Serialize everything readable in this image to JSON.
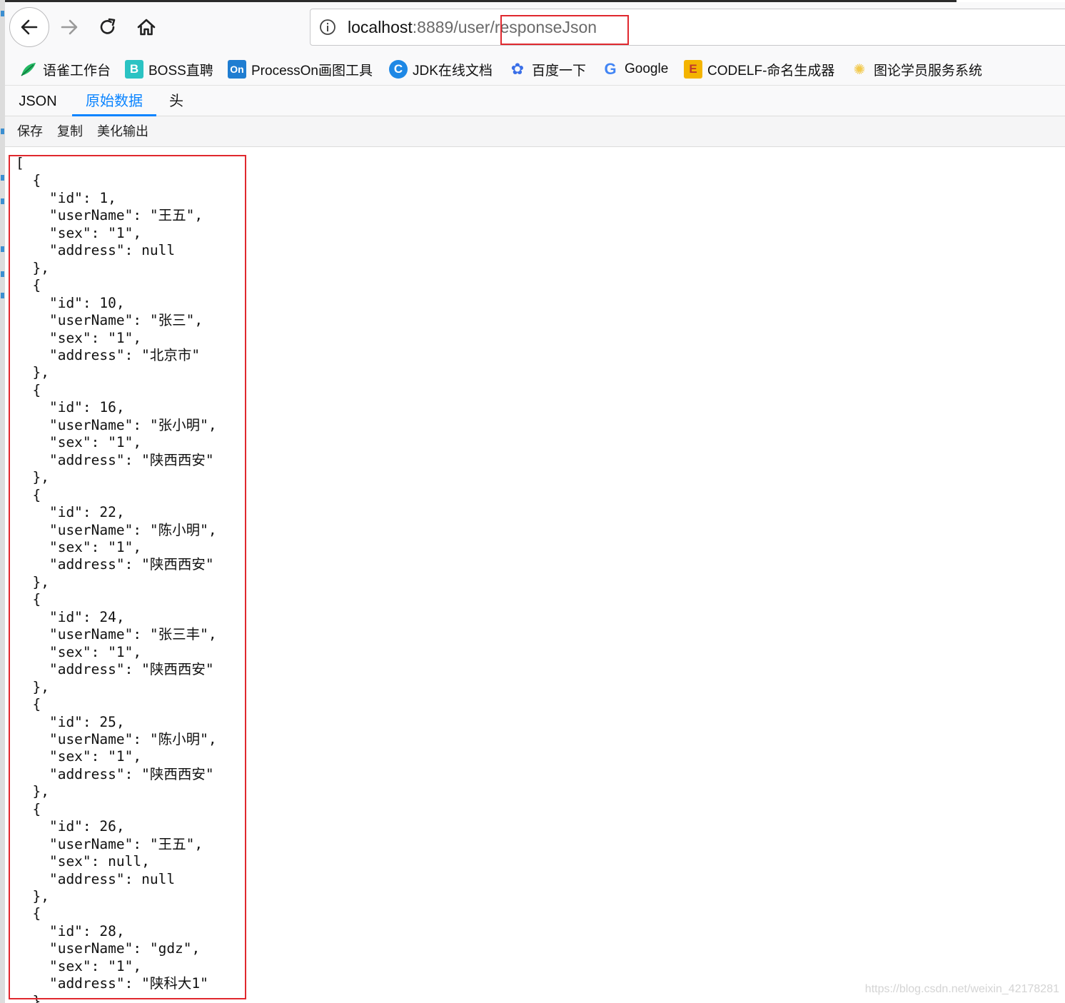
{
  "browser": {
    "url_host": "localhost",
    "url_rest": ":8889/user/responseJson"
  },
  "bookmarks": [
    {
      "label": "语雀工作台",
      "icon": "yuque-icon",
      "icon_glyph": "",
      "color": "#25b864"
    },
    {
      "label": "BOSS直聘",
      "icon": "boss-icon",
      "icon_glyph": "B",
      "color": "#2bc3c3"
    },
    {
      "label": "ProcessOn画图工具",
      "icon": "processon-icon",
      "icon_glyph": "On",
      "color": "#1f7dd1"
    },
    {
      "label": "JDK在线文档",
      "icon": "jdk-icon",
      "icon_glyph": "C",
      "color": "#1e88e5"
    },
    {
      "label": "百度一下",
      "icon": "baidu-icon",
      "icon_glyph": "✿",
      "color": "#3a6fe8"
    },
    {
      "label": "Google",
      "icon": "google-icon",
      "icon_glyph": "G",
      "color": "#4285f4"
    },
    {
      "label": "CODELF-命名生成器",
      "icon": "codelf-icon",
      "icon_glyph": "E",
      "color": "#f4b400"
    },
    {
      "label": "图论学员服务系统",
      "icon": "tulun-icon",
      "icon_glyph": "✺",
      "color": "#f2c94c"
    }
  ],
  "viewer": {
    "tabs": [
      "JSON",
      "原始数据",
      "头"
    ],
    "active_tab": "原始数据",
    "actions": [
      "保存",
      "复制",
      "美化输出"
    ]
  },
  "raw_text": "[\n  {\n    \"id\": 1,\n    \"userName\": \"王五\",\n    \"sex\": \"1\",\n    \"address\": null\n  },\n  {\n    \"id\": 10,\n    \"userName\": \"张三\",\n    \"sex\": \"1\",\n    \"address\": \"北京市\"\n  },\n  {\n    \"id\": 16,\n    \"userName\": \"张小明\",\n    \"sex\": \"1\",\n    \"address\": \"陕西西安\"\n  },\n  {\n    \"id\": 22,\n    \"userName\": \"陈小明\",\n    \"sex\": \"1\",\n    \"address\": \"陕西西安\"\n  },\n  {\n    \"id\": 24,\n    \"userName\": \"张三丰\",\n    \"sex\": \"1\",\n    \"address\": \"陕西西安\"\n  },\n  {\n    \"id\": 25,\n    \"userName\": \"陈小明\",\n    \"sex\": \"1\",\n    \"address\": \"陕西西安\"\n  },\n  {\n    \"id\": 26,\n    \"userName\": \"王五\",\n    \"sex\": null,\n    \"address\": null\n  },\n  {\n    \"id\": 28,\n    \"userName\": \"gdz\",\n    \"sex\": \"1\",\n    \"address\": \"陕科大1\"\n  },",
  "watermark": "https://blog.csdn.net/weixin_42178281",
  "colors": {
    "accent": "#0a84ff",
    "highlight_box": "#e0282e"
  }
}
